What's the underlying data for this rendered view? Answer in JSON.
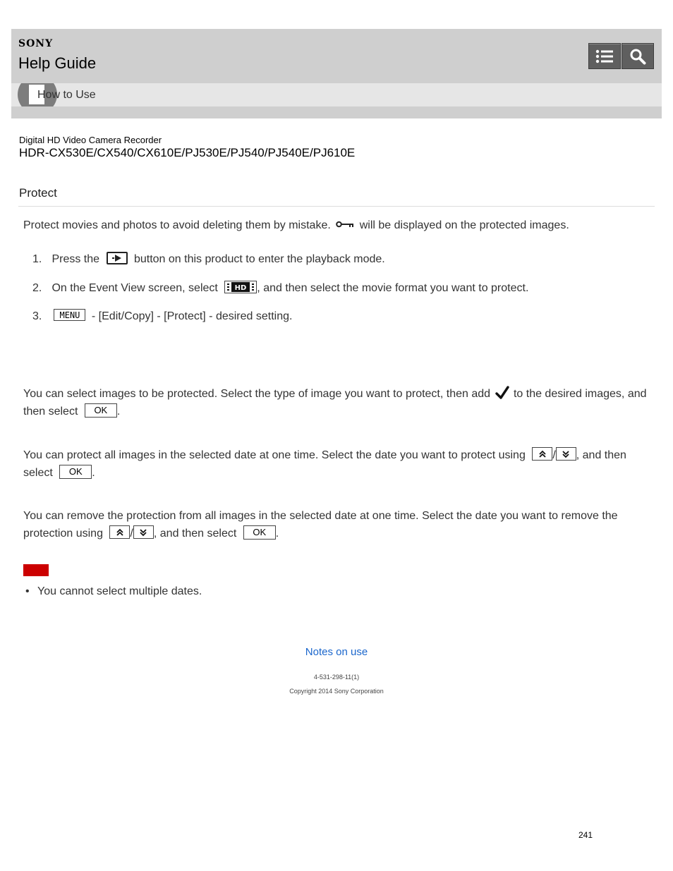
{
  "header": {
    "brand": "SONY",
    "title": "Help Guide",
    "list_button_icon": "list-icon",
    "search_button_icon": "search-icon",
    "bar_color": "#cfcfcf"
  },
  "subnav": {
    "label": "How to Use",
    "icon": "document-icon"
  },
  "meta": {
    "product": "Digital HD Video Camera Recorder",
    "models": "HDR-CX530E/CX540/CX610E/PJ530E/PJ540/PJ540E/PJ610E"
  },
  "page": {
    "title": "Protect"
  },
  "intro": {
    "before": "Protect movies and photos to avoid deleting them by mistake.",
    "after": "will be displayed on the protected images.",
    "icon": "key-icon"
  },
  "steps": [
    {
      "num": "1.",
      "before": "Press the",
      "after": "button on this product to enter the playback mode.",
      "icon": "playback-button-icon"
    },
    {
      "num": "2.",
      "before": "On the Event View screen, select",
      "after": ", and then select the movie format you want to protect.",
      "icon": "hd-format-icon"
    },
    {
      "num": "3.",
      "menu_label": "MENU",
      "after": "- [Edit/Copy] - [Protect] - desired setting."
    }
  ],
  "sections": {
    "multiple": {
      "before": "You can select images to be protected. Select the type of image you want to protect, then add",
      "middle": "to the desired images, and then select",
      "end": ".",
      "ok_label": "OK",
      "icon": "checkmark-icon"
    },
    "all_in_date": {
      "before": "You can protect all images in the selected date at one time. Select the date you want to protect using",
      "slash": "/",
      "middle": ", and then select",
      "end": ".",
      "ok_label": "OK"
    },
    "cancel_all": {
      "before": "You can remove the protection from all images in the selected date at one time. Select the date you want to remove the protection using",
      "slash": "/",
      "middle": ", and then select",
      "end": ".",
      "ok_label": "OK"
    }
  },
  "note": {
    "badge_color": "#cc0000",
    "bullets": [
      "You cannot select multiple dates."
    ]
  },
  "footer": {
    "link": "Notes on use",
    "doc_number": "4-531-298-11(1)",
    "copyright": "Copyright 2014 Sony Corporation",
    "page_number": "241",
    "link_color": "#1a66cc"
  }
}
